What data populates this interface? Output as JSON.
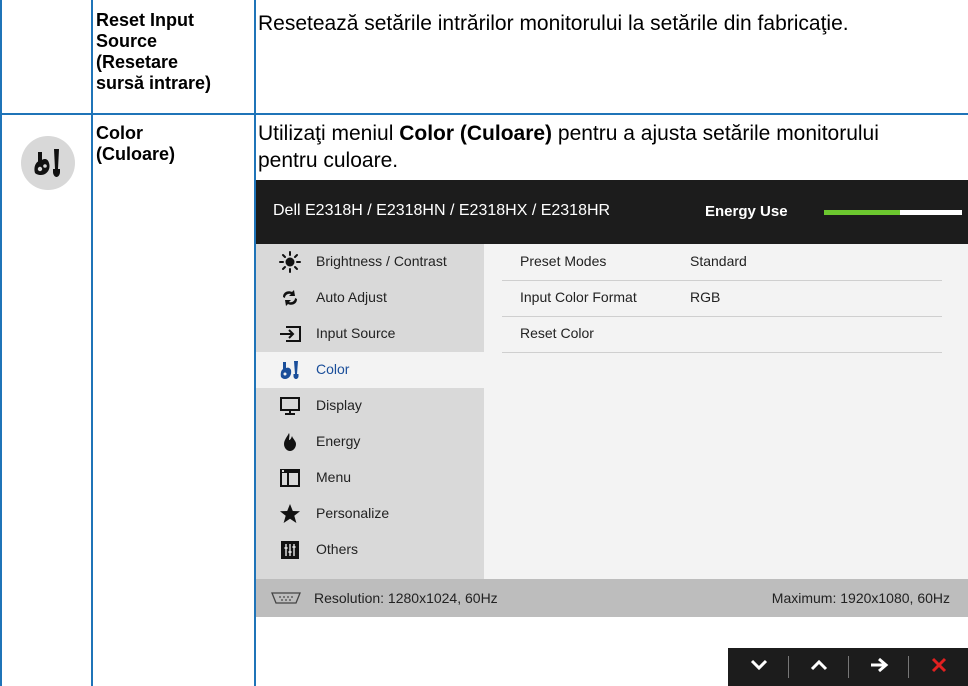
{
  "rows": [
    {
      "name": "Reset Input Source (Resetare sursă intrare)",
      "name_lines": [
        "Reset Input",
        "Source",
        "(Resetare",
        "sursă intrare)"
      ],
      "description": "Resetează setările intrărilor monitorului la setările din fabricaţie."
    },
    {
      "icon": "color-palette-icon",
      "name_lines": [
        "Color",
        "(Culoare)"
      ],
      "description_parts": {
        "before": "Utilizaţi meniul ",
        "bold": "Color (Culoare)",
        "after_line1": " pentru a ajusta setările monitorului",
        "line2": "pentru culoare."
      }
    }
  ],
  "osd": {
    "model": "Dell E2318H / E2318HN / E2318HX / E2318HR",
    "energy_label": "Energy Use",
    "energy_level": 0.55,
    "menu": [
      {
        "label": "Brightness / Contrast",
        "icon": "brightness-icon"
      },
      {
        "label": "Auto Adjust",
        "icon": "auto-adjust-icon"
      },
      {
        "label": "Input Source",
        "icon": "input-source-icon"
      },
      {
        "label": "Color",
        "icon": "color-palette-icon",
        "active": true
      },
      {
        "label": "Display",
        "icon": "display-icon"
      },
      {
        "label": "Energy",
        "icon": "energy-icon"
      },
      {
        "label": "Menu",
        "icon": "menu-icon"
      },
      {
        "label": "Personalize",
        "icon": "star-icon"
      },
      {
        "label": "Others",
        "icon": "others-icon"
      }
    ],
    "settings": [
      {
        "name": "Preset Modes",
        "value": "Standard"
      },
      {
        "name": "Input Color Format",
        "value": "RGB"
      },
      {
        "name": "Reset Color",
        "value": ""
      }
    ],
    "status": {
      "resolution": "Resolution: 1280x1024, 60Hz",
      "maximum": "Maximum: 1920x1080, 60Hz"
    },
    "nav_buttons": [
      {
        "icon": "chevron-down-icon"
      },
      {
        "icon": "chevron-up-icon"
      },
      {
        "icon": "arrow-right-icon"
      },
      {
        "icon": "close-icon",
        "color": "#e02020"
      }
    ],
    "colors": {
      "accent_border": "#1f74b8",
      "energy_green": "#6cc72f",
      "header_bg": "#1c1c1c"
    }
  }
}
